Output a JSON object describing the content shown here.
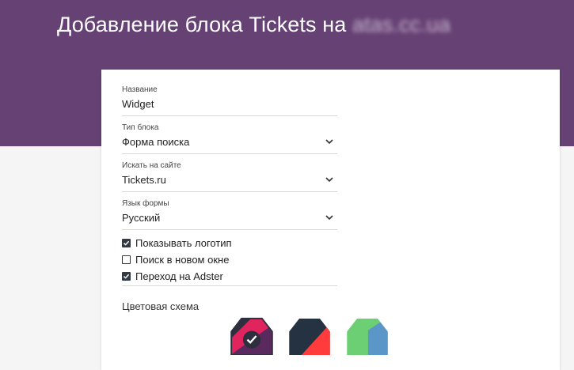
{
  "header": {
    "title_prefix": "Добавление блока Tickets на",
    "domain": "atas.cc.ua"
  },
  "form": {
    "name": {
      "label": "Название",
      "value": "Widget"
    },
    "block_type": {
      "label": "Тип блока",
      "value": "Форма поиска"
    },
    "search_site": {
      "label": "Искать на сайте",
      "value": "Tickets.ru"
    },
    "form_language": {
      "label": "Язык формы",
      "value": "Русский"
    }
  },
  "options": [
    {
      "label": "Показывать логотип",
      "checked": true
    },
    {
      "label": "Поиск в новом окне",
      "checked": false
    },
    {
      "label": "Переход на Adster",
      "checked": true
    }
  ],
  "color_scheme": {
    "title": "Цветовая схема",
    "swatches": [
      {
        "name": "dark-pink",
        "colors": [
          "#2d2e3e",
          "#e0245e",
          "#5a2a5e"
        ],
        "selected": true
      },
      {
        "name": "navy-red",
        "colors": [
          "#243241",
          "#ff3b3b"
        ],
        "selected": false
      },
      {
        "name": "green-blue",
        "colors": [
          "#6ccf74",
          "#5a96c8"
        ],
        "selected": false
      }
    ]
  },
  "colors": {
    "header_bg": "#664174",
    "checkbox_on": "#333a44"
  }
}
